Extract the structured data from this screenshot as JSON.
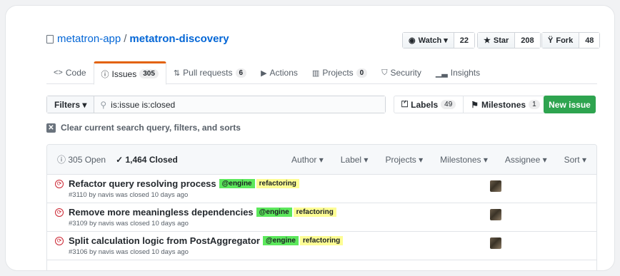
{
  "repo": {
    "owner": "metatron-app",
    "separator": "/",
    "name": "metatron-discovery"
  },
  "social": {
    "watch": {
      "label": "Watch ▾",
      "count": "22"
    },
    "star": {
      "label": "Star",
      "count": "208"
    },
    "fork": {
      "label": "Fork",
      "count": "48"
    }
  },
  "tabs": [
    {
      "label": "Code",
      "count": ""
    },
    {
      "label": "Issues",
      "count": "305"
    },
    {
      "label": "Pull requests",
      "count": "6"
    },
    {
      "label": "Actions",
      "count": ""
    },
    {
      "label": "Projects",
      "count": "0"
    },
    {
      "label": "Security",
      "count": ""
    },
    {
      "label": "Insights",
      "count": ""
    }
  ],
  "filters": {
    "label": "Filters ▾",
    "query": "is:issue is:closed"
  },
  "labels_btn": {
    "label": "Labels",
    "count": "49"
  },
  "milestones_btn": {
    "label": "Milestones",
    "count": "1"
  },
  "new_issue": "New issue",
  "clear_text": "Clear current search query, filters, and sorts",
  "list_head": {
    "open": "305 Open",
    "closed": "1,464 Closed",
    "sorts": [
      "Author ▾",
      "Label ▾",
      "Projects ▾",
      "Milestones ▾",
      "Assignee ▾",
      "Sort ▾"
    ]
  },
  "issues": [
    {
      "title": "Refactor query resolving process",
      "label1": "@engine",
      "label2": "refactoring",
      "meta": "#3110 by navis was closed 10 days ago"
    },
    {
      "title": "Remove more meaningless dependencies",
      "label1": "@engine",
      "label2": "refactoring",
      "meta": "#3109 by navis was closed 10 days ago"
    },
    {
      "title": "Split calculation logic from PostAggregator",
      "label1": "@engine",
      "label2": "refactoring",
      "meta": "#3106 by navis was closed 10 days ago"
    }
  ],
  "colors": {
    "link": "#0366d6",
    "closed": "#cb2431",
    "engine": "#5ce85c",
    "refactoring": "#fdfd94",
    "primary": "#2ea44f",
    "tab_accent": "#e36209"
  }
}
